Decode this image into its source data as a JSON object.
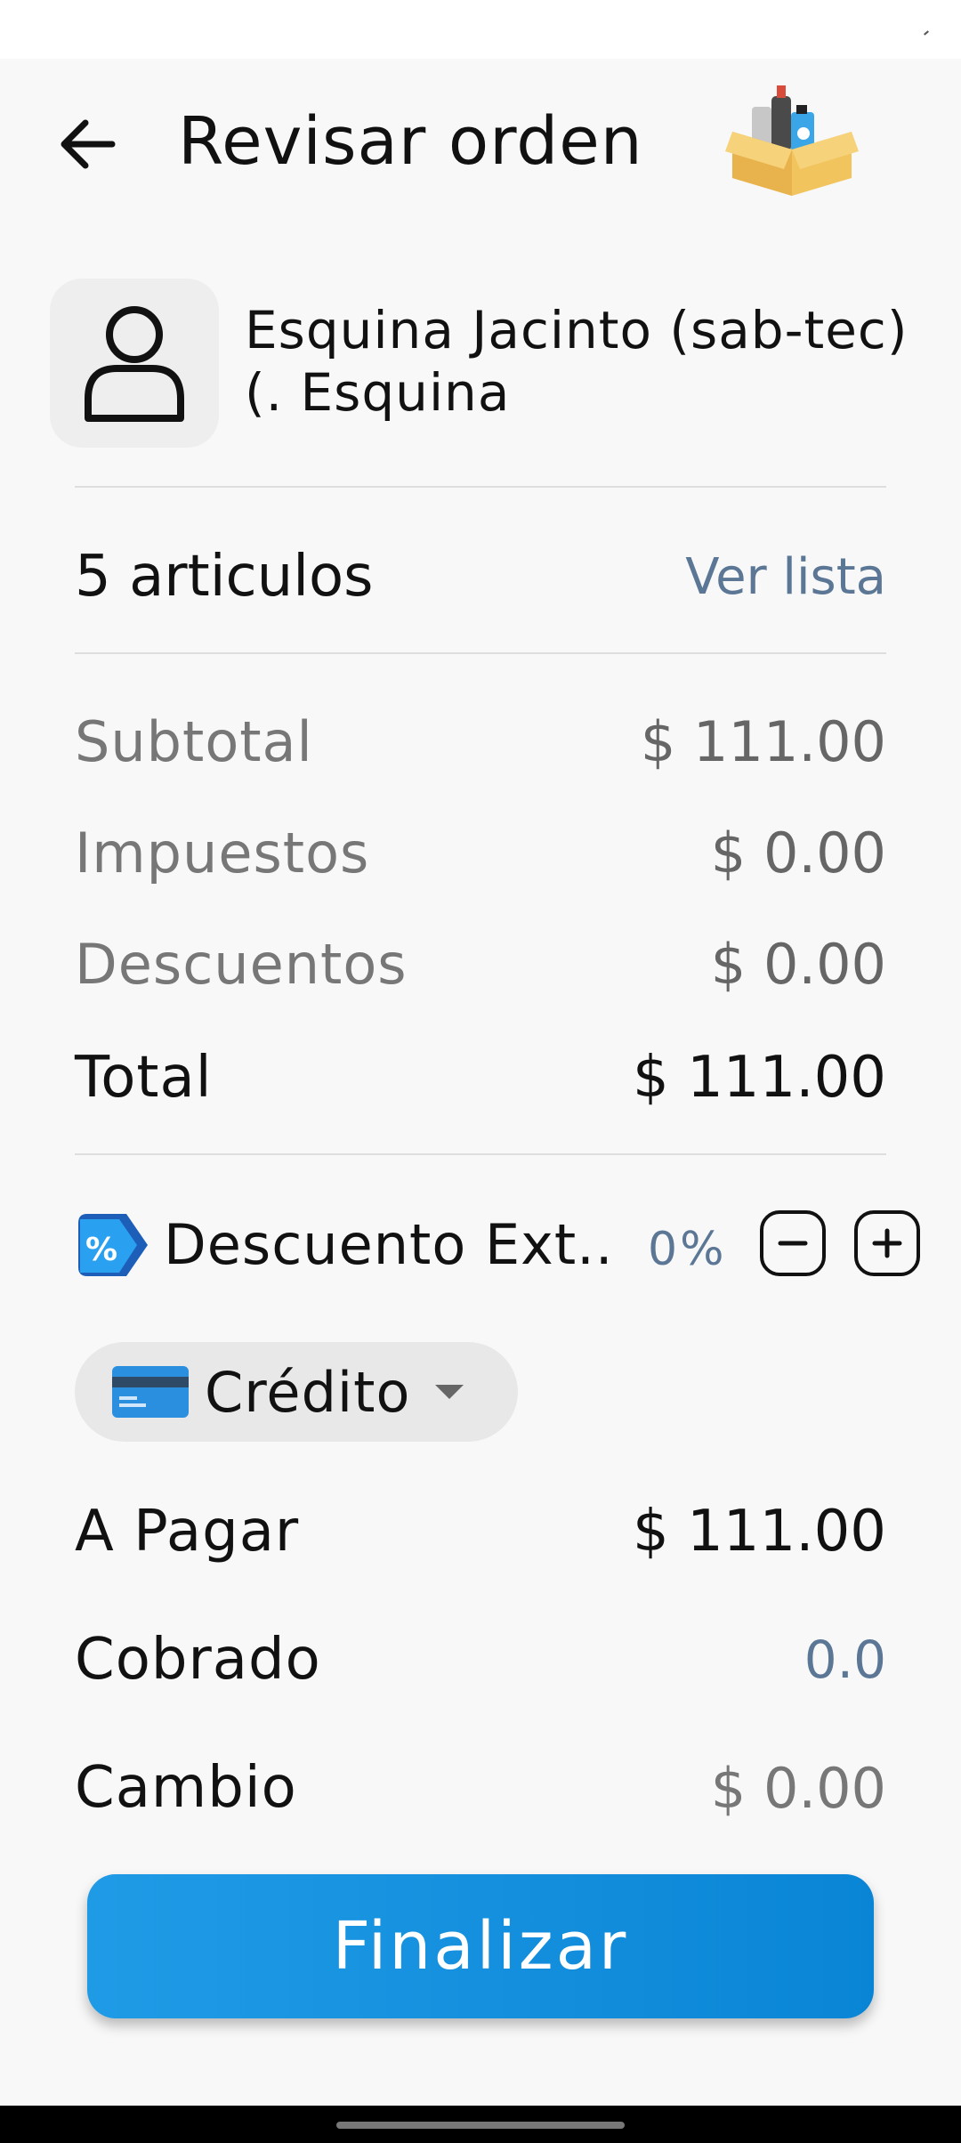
{
  "header": {
    "title": "Revisar orden",
    "back_icon": "arrow-left-icon",
    "logo_icon": "box-with-bottles-icon"
  },
  "customer": {
    "avatar_icon": "user-icon",
    "name": "Esquina Jacinto (sab-tec) (. Esquina"
  },
  "items": {
    "count_label": "5 articulos",
    "view_list_label": "Ver lista"
  },
  "summary": {
    "subtotal_label": "Subtotal",
    "subtotal_value": "$ 111.00",
    "taxes_label": "Impuestos",
    "taxes_value": "$ 0.00",
    "discounts_label": "Descuentos",
    "discounts_value": "$ 0.00",
    "total_label": "Total",
    "total_value": "$ 111.00"
  },
  "extra_discount": {
    "icon": "discount-tag-icon",
    "label": "Descuento Ext...",
    "percent": "0%",
    "minus_icon": "minus-icon",
    "plus_icon": "plus-icon"
  },
  "payment": {
    "method_icon": "credit-card-icon",
    "method_label": "Crédito",
    "dropdown_icon": "caret-down-icon"
  },
  "totals": {
    "to_pay_label": "A Pagar",
    "to_pay_value": "$ 111.00",
    "charged_label": "Cobrado",
    "charged_value": "0.0",
    "change_label": "Cambio",
    "change_value": "$ 0.00"
  },
  "actions": {
    "finish_label": "Finalizar"
  },
  "colors": {
    "accent": "#1294e0",
    "link": "#5b7795",
    "background": "#f8f8f8"
  }
}
